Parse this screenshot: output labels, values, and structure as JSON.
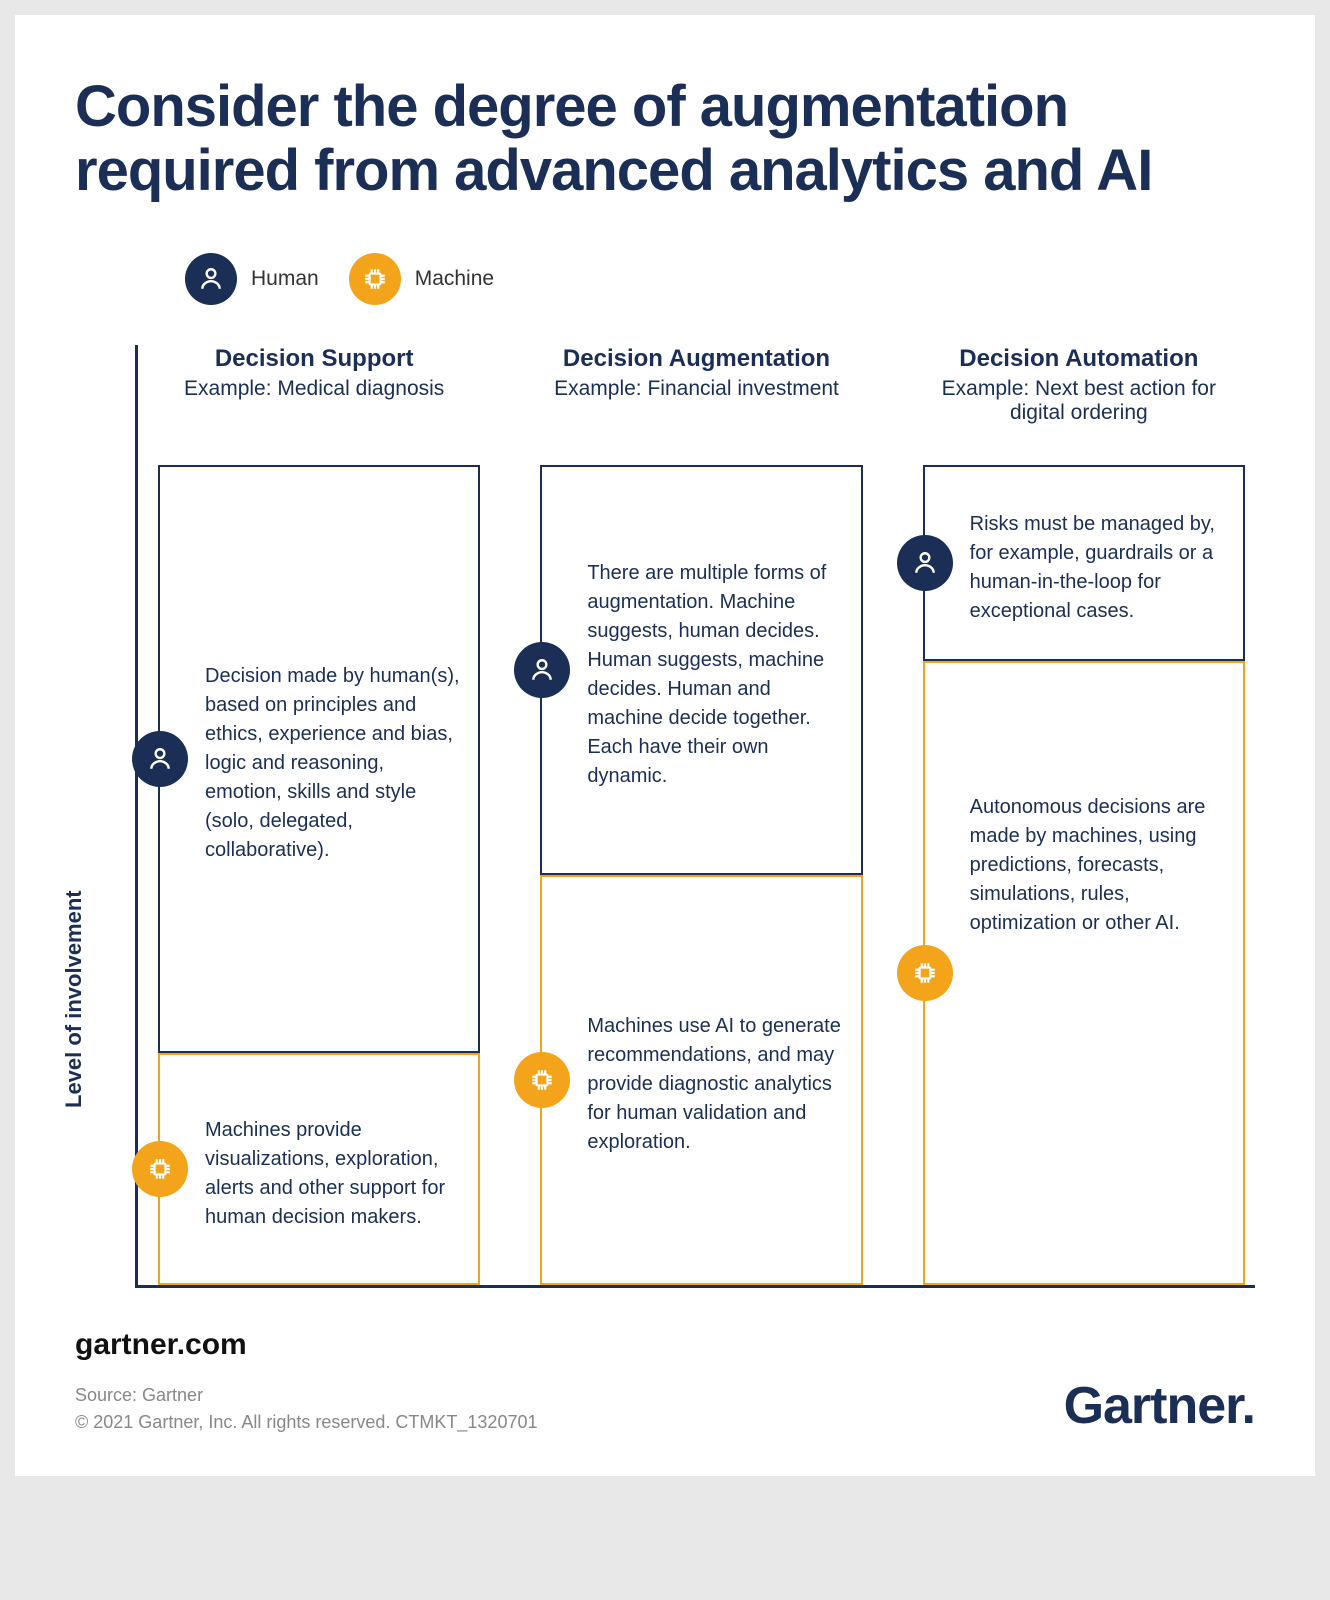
{
  "title": "Consider the degree of augmentation required from advanced analytics and AI",
  "legend": {
    "human": "Human",
    "machine": "Machine"
  },
  "yaxis_label": "Level of involvement",
  "columns": [
    {
      "title": "Decision Support",
      "example": "Example: Medical diagnosis",
      "human_text": "Decision made by human(s), based on principles and ethics, experience and bias, logic and reasoning, emotion, skills and style (solo, delegated, collaborative).",
      "machine_text": "Machines provide visualizations, exploration, alerts and other support for human decision makers."
    },
    {
      "title": "Decision Augmentation",
      "example": "Example: Financial investment",
      "human_text": "There are multiple forms of augmentation. Machine suggests, human decides. Human suggests, machine decides. Human and machine decide together. Each have their own dynamic.",
      "machine_text": "Machines use AI to generate recommendations, and may provide diagnostic analytics for human validation and exploration."
    },
    {
      "title": "Decision Automation",
      "example": "Example: Next best action for digital ordering",
      "human_text": "Risks must be managed by, for example, guardrails or a human-in-the-loop for exceptional cases.",
      "machine_text": "Autonomous decisions are made by machines, using predictions, forecasts, simulations, rules, optimization or other AI."
    }
  ],
  "chart_data": {
    "type": "bar",
    "note": "Qualitative stacked proportion of Human vs Machine involvement per decision type (approximate proportions read from figure).",
    "categories": [
      "Decision Support",
      "Decision Augmentation",
      "Decision Automation"
    ],
    "series": [
      {
        "name": "Human",
        "values": [
          75,
          50,
          20
        ]
      },
      {
        "name": "Machine",
        "values": [
          25,
          50,
          80
        ]
      }
    ],
    "ylabel": "Level of involvement",
    "ylim": [
      0,
      100
    ]
  },
  "footer": {
    "link": "gartner.com",
    "source": "Source: Gartner",
    "copyright": "© 2021 Gartner, Inc. All rights reserved. CTMKT_1320701",
    "brand": "Gartner"
  }
}
